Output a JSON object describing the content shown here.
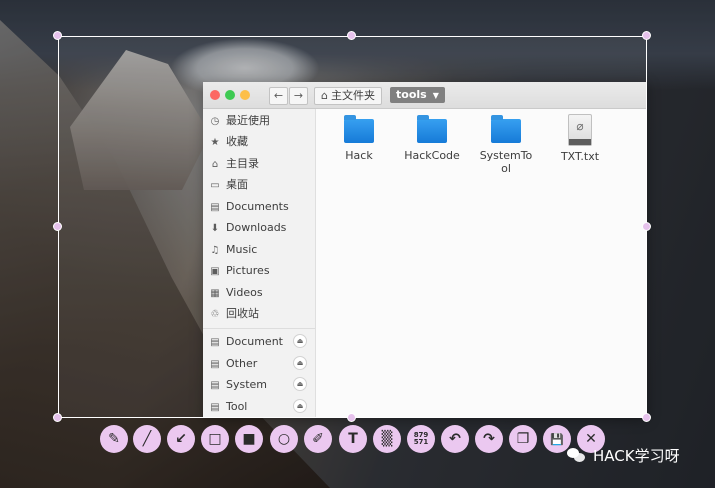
{
  "window": {
    "nav_back": "←",
    "nav_forward": "→",
    "breadcrumb_home": "主文件夹",
    "breadcrumb_current": "tools"
  },
  "sidebar": {
    "items": [
      {
        "label": "最近使用",
        "icon": "clock-icon",
        "glyph": "◷"
      },
      {
        "label": "收藏",
        "icon": "star-icon",
        "glyph": "★"
      },
      {
        "label": "主目录",
        "icon": "home-icon",
        "glyph": "⌂"
      },
      {
        "label": "桌面",
        "icon": "desktop-icon",
        "glyph": "▭"
      },
      {
        "label": "Documents",
        "icon": "documents-icon",
        "glyph": "▤"
      },
      {
        "label": "Downloads",
        "icon": "downloads-icon",
        "glyph": "⬇"
      },
      {
        "label": "Music",
        "icon": "music-icon",
        "glyph": "♫"
      },
      {
        "label": "Pictures",
        "icon": "pictures-icon",
        "glyph": "▣"
      },
      {
        "label": "Videos",
        "icon": "videos-icon",
        "glyph": "▦"
      },
      {
        "label": "回收站",
        "icon": "trash-icon",
        "glyph": "♲"
      }
    ],
    "devices": [
      {
        "label": "Document",
        "icon": "drive-icon",
        "glyph": "▤"
      },
      {
        "label": "Other",
        "icon": "drive-icon",
        "glyph": "▤"
      },
      {
        "label": "System",
        "icon": "drive-icon",
        "glyph": "▤"
      },
      {
        "label": "Tool",
        "icon": "drive-icon",
        "glyph": "▤"
      }
    ],
    "eject_glyph": "⏏"
  },
  "files": [
    {
      "name": "Hack",
      "type": "folder"
    },
    {
      "name": "HackCode",
      "type": "folder"
    },
    {
      "name": "SystemTo\nol",
      "type": "folder"
    },
    {
      "name": "TXT.txt",
      "type": "text"
    }
  ],
  "toolbar": [
    {
      "name": "pencil-tool",
      "glyph": "✎"
    },
    {
      "name": "line-tool",
      "glyph": "╱"
    },
    {
      "name": "arrow-tool",
      "glyph": "↙"
    },
    {
      "name": "rectangle-tool",
      "glyph": "□"
    },
    {
      "name": "filled-rectangle-tool",
      "glyph": "■"
    },
    {
      "name": "circle-tool",
      "glyph": "○"
    },
    {
      "name": "marker-tool",
      "glyph": "✐"
    },
    {
      "name": "text-tool",
      "glyph": "T"
    },
    {
      "name": "blur-tool",
      "glyph": "▒"
    },
    {
      "name": "selection-size-tool",
      "glyph": "879\n571"
    },
    {
      "name": "undo-tool",
      "glyph": "↶"
    },
    {
      "name": "redo-tool",
      "glyph": "↷"
    },
    {
      "name": "copy-tool",
      "glyph": "❐"
    },
    {
      "name": "save-tool",
      "glyph": "💾"
    },
    {
      "name": "close-tool",
      "glyph": "✕"
    }
  ],
  "watermark": {
    "text": "HACK学习呀",
    "icon": "wechat-icon"
  },
  "colors": {
    "toolbar_button": "#ebc8f0",
    "folder": "#1a86e4",
    "breadcrumb_active": "#7a7a7a"
  }
}
